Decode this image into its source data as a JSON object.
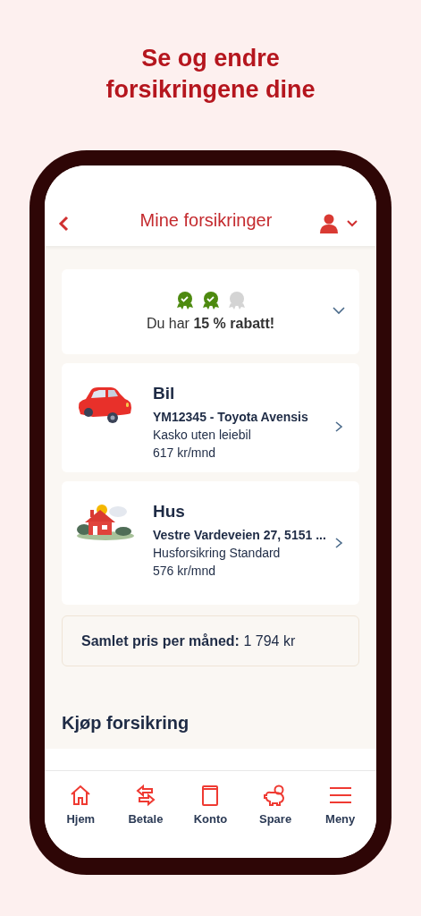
{
  "headline": [
    "Se og endre",
    "forsikringene dine"
  ],
  "header": {
    "title": "Mine forsikringer"
  },
  "discount": {
    "medals": [
      {
        "earned": true
      },
      {
        "earned": true
      },
      {
        "earned": false
      }
    ],
    "text": "Du har **15 % rabatt!**"
  },
  "insurances": [
    {
      "kind": "car",
      "title": "Bil",
      "subtitle": "YM12345 - Toyota Avensis",
      "product": "Kasko uten leiebil",
      "price": "617 kr/mnd"
    },
    {
      "kind": "house",
      "title": "Hus",
      "subtitle": "Vestre Vardeveien 27, 5151 ...",
      "product": "Husforsikring Standard",
      "price": "576 kr/mnd"
    }
  ],
  "total": "**Samlet pris per måned:** 1 794 kr",
  "buy_heading": "Kjøp forsikring",
  "tabs": [
    {
      "kind": "home",
      "label": "Hjem"
    },
    {
      "kind": "transfer",
      "label": "Betale"
    },
    {
      "kind": "book",
      "label": "Konto"
    },
    {
      "kind": "piggy",
      "label": "Spare"
    },
    {
      "kind": "menu",
      "label": "Meny"
    }
  ]
}
